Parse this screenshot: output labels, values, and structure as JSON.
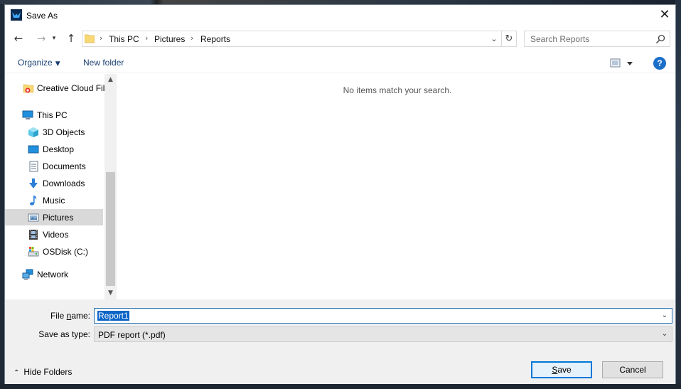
{
  "window": {
    "title": "Save As",
    "close_label": "✕"
  },
  "nav": {
    "back_icon": "arrow-left-icon",
    "forward_icon": "arrow-right-icon",
    "history_icon": "chevron-down-icon",
    "up_icon": "arrow-up-icon"
  },
  "address": {
    "breadcrumbs": [
      "This PC",
      "Pictures",
      "Reports"
    ],
    "separator": "›"
  },
  "search": {
    "placeholder": "Search Reports"
  },
  "toolbar": {
    "organize_label": "Organize",
    "new_folder_label": "New folder",
    "help_label": "?"
  },
  "sidebar": {
    "items": [
      {
        "label": "Creative Cloud Fil",
        "icon": "creative-cloud-icon"
      },
      {
        "label": "This PC",
        "icon": "computer-icon"
      },
      {
        "label": "3D Objects",
        "icon": "cube-icon"
      },
      {
        "label": "Desktop",
        "icon": "desktop-icon"
      },
      {
        "label": "Documents",
        "icon": "document-icon"
      },
      {
        "label": "Downloads",
        "icon": "download-icon"
      },
      {
        "label": "Music",
        "icon": "music-note-icon"
      },
      {
        "label": "Pictures",
        "icon": "pictures-icon",
        "selected": true
      },
      {
        "label": "Videos",
        "icon": "film-icon"
      },
      {
        "label": "OSDisk (C:)",
        "icon": "disk-icon"
      },
      {
        "label": "Network",
        "icon": "network-icon"
      }
    ]
  },
  "main": {
    "empty_message": "No items match your search."
  },
  "form": {
    "file_name_label": "File name:",
    "file_name_label_pre": "File ",
    "file_name_label_accel": "n",
    "file_name_label_post": "ame:",
    "file_name_value": "Report1",
    "save_type_label": "Save as type:",
    "save_type_value": "PDF report (*.pdf)",
    "hide_folders_label": "Hide Folders",
    "save_label_accel": "S",
    "save_label_rest": "ave",
    "cancel_label": "Cancel"
  },
  "colors": {
    "accent": "#0078d7",
    "selection": "#0a64c8",
    "link": "#1a3f73"
  }
}
